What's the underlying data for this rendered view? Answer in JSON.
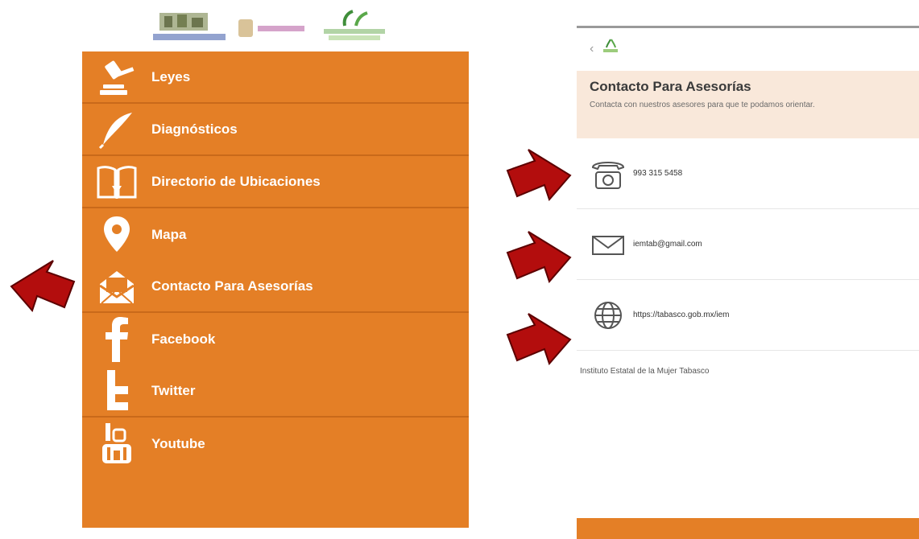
{
  "colors": {
    "menu_bg": "#e47f26",
    "menu_separator": "#c9691a",
    "header_bg": "#f9e8da",
    "arrow": "#b30d0d",
    "text_white": "#ffffff"
  },
  "logos": [
    "header-logo-1",
    "header-logo-tabasco",
    "header-logo-3"
  ],
  "menu": {
    "items": [
      {
        "label": "Leyes",
        "icon": "gavel-icon"
      },
      {
        "label": "Diagnósticos",
        "icon": "feather-icon"
      },
      {
        "label": "Directorio de Ubicaciones",
        "icon": "book-icon"
      },
      {
        "label": "Mapa",
        "icon": "map-pin-icon"
      },
      {
        "label": "Contacto Para Asesorías",
        "icon": "envelope-open-icon"
      },
      {
        "label": "Facebook",
        "icon": "facebook-icon"
      },
      {
        "label": "Twitter",
        "icon": "twitter-icon"
      },
      {
        "label": "Youtube",
        "icon": "youtube-icon"
      }
    ]
  },
  "contact_screen": {
    "back_icon": "back-chevron-icon",
    "header_title": "Contacto Para Asesorías",
    "header_subtitle": "Contacta con nuestros asesores para que te podamos orientar.",
    "rows": [
      {
        "icon": "telephone-icon",
        "text": "993 315 5458"
      },
      {
        "icon": "mail-icon",
        "text": "iemtab@gmail.com"
      },
      {
        "icon": "globe-icon",
        "text": "https://tabasco.gob.mx/iem"
      }
    ],
    "footer": "Instituto Estatal de la Mujer Tabasco"
  }
}
